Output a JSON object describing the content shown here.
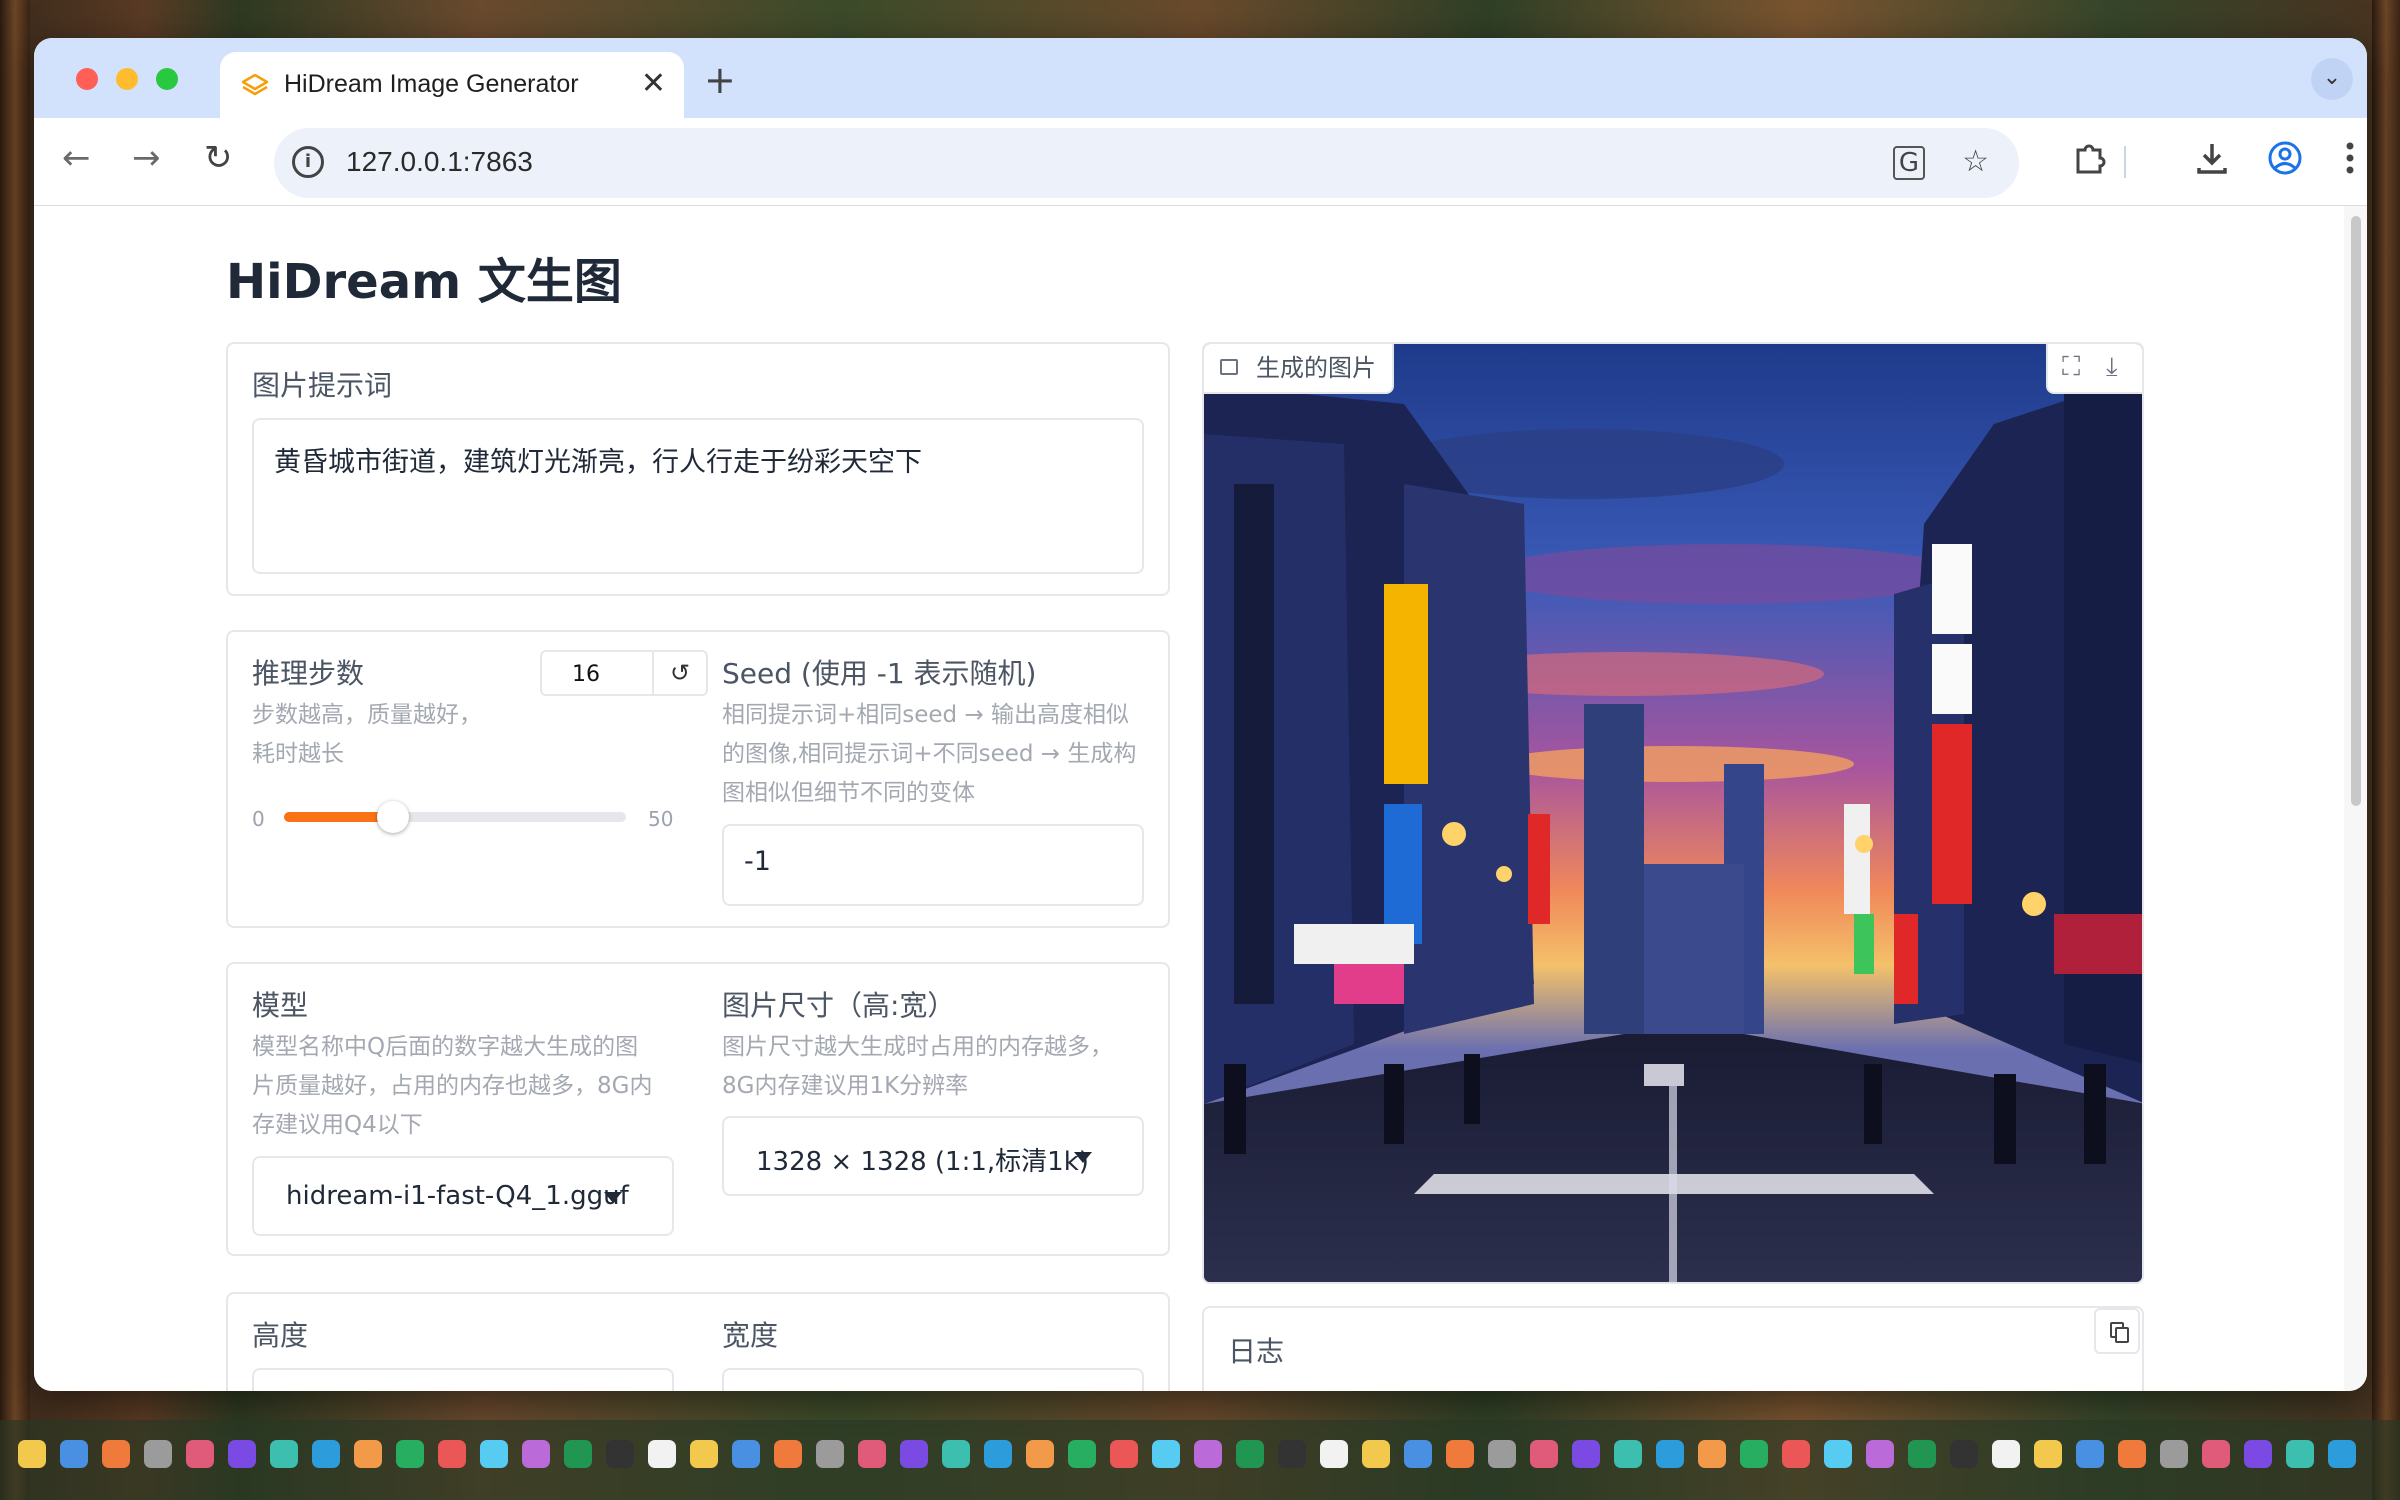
{
  "browser": {
    "tab_title": "HiDream Image Generator",
    "tab_close": "✕",
    "new_tab": "+",
    "tab_menu": "⌄",
    "url": "127.0.0.1:7863",
    "info_glyph": "i"
  },
  "page": {
    "title": "HiDream 文生图"
  },
  "prompt": {
    "label": "图片提示词",
    "value": "黄昏城市街道，建筑灯光渐亮，行人行走于纷彩天空下"
  },
  "steps": {
    "label": "推理步数",
    "info_line1": "步数越高，质量越好，",
    "info_line2": "耗时越长",
    "value": "16",
    "min": "0",
    "max": "50",
    "reset_glyph": "↺"
  },
  "seed": {
    "label": "Seed (使用 -1 表示随机)",
    "info_line1": "相同提示词+相同seed → 输出高度相似",
    "info_line2": "的图像,相同提示词+不同seed → 生成构",
    "info_line3": "图相似但细节不同的变体",
    "value": "-1"
  },
  "model": {
    "label": "模型",
    "info_line1": "模型名称中Q后面的数字越大生成的图",
    "info_line2": "片质量越好，占用的内存也越多，8G内",
    "info_line3": "存建议用Q4以下",
    "selected": "hidream-i1-fast-Q4_1.gguf"
  },
  "size": {
    "label": "图片尺寸（高:宽）",
    "info_line1": "图片尺寸越大生成时占用的内存越多，",
    "info_line2": "8G内存建议用1K分辨率",
    "selected": "1328 × 1328 (1:1,标清1k)"
  },
  "dims": {
    "height_label": "高度",
    "width_label": "宽度"
  },
  "output": {
    "image_label": "生成的图片",
    "fullscreen_glyph": "⛶",
    "download_glyph": "⤓"
  },
  "log": {
    "label": "日志"
  },
  "colors": {
    "accent": "#f97316",
    "tab_bar": "#d3e2fc",
    "close_dot": "#ff5f57",
    "min_dot": "#febc2e",
    "max_dot": "#28c840"
  },
  "icons": [
    "back-arrow-icon",
    "forward-arrow-icon",
    "reload-icon",
    "translate-icon",
    "star-icon",
    "extensions-icon",
    "download-icon",
    "profile-icon",
    "kebab-menu-icon"
  ]
}
